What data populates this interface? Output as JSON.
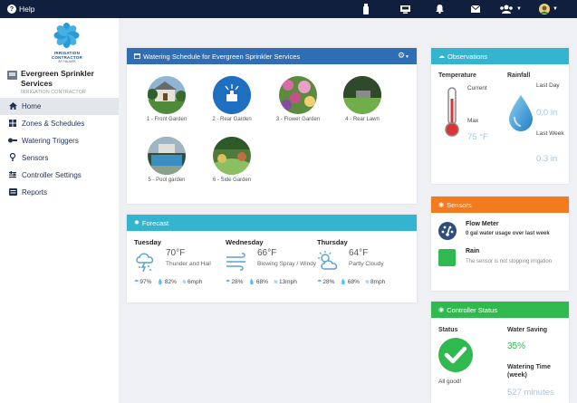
{
  "topbar": {
    "help_label": "Help",
    "icons": [
      "usb-icon",
      "monitor-icon",
      "bell-icon",
      "envelope-icon",
      "users-icon",
      "avatar"
    ]
  },
  "sidebar": {
    "logo_text": "IRRIGATION CONTRACTOR",
    "logo_sub": "BY HAJLER",
    "site_name": "Evergreen Sprinkler Services",
    "site_sub": "IRRIGATION CONTRACTOR",
    "items": [
      {
        "label": "Home",
        "icon": "home-icon",
        "active": true
      },
      {
        "label": "Zones & Schedules",
        "icon": "zones-icon",
        "active": false
      },
      {
        "label": "Watering Triggers",
        "icon": "triggers-icon",
        "active": false
      },
      {
        "label": "Sensors",
        "icon": "sensor-icon",
        "active": false
      },
      {
        "label": "Controller Settings",
        "icon": "settings-icon",
        "active": false
      },
      {
        "label": "Reports",
        "icon": "reports-icon",
        "active": false
      }
    ]
  },
  "schedule": {
    "title": "Watering Schedule for Evergreen Sprinkler Services",
    "zones": [
      {
        "label": "1 - Front Garden"
      },
      {
        "label": "2 - Rear Garden"
      },
      {
        "label": "3 - Flower Garden"
      },
      {
        "label": "4 - Rear Lawn"
      },
      {
        "label": "5 - Pool garden"
      },
      {
        "label": "6 - Side Garden"
      }
    ]
  },
  "forecast": {
    "title": "Forecast",
    "days": [
      {
        "day": "Tuesday",
        "temp": "70°F",
        "cond": "Thunder and Hail",
        "rain": "97%",
        "humidity": "82%",
        "wind": "6mph"
      },
      {
        "day": "Wednesday",
        "temp": "66°F",
        "cond": "Blowing Spray / Windy",
        "rain": "28%",
        "humidity": "68%",
        "wind": "13mph"
      },
      {
        "day": "Thursday",
        "temp": "64°F",
        "cond": "Partly Cloudy",
        "rain": "28%",
        "humidity": "68%",
        "wind": "8mph"
      }
    ]
  },
  "observations": {
    "title": "Observations",
    "temperature_label": "Temperature",
    "current_label": "Current",
    "max_label": "Max",
    "max_value": "75 °F",
    "rainfall_label": "Rainfall",
    "last_day_label": "Last Day",
    "last_day_value": "0.0 in",
    "last_week_label": "Last Week",
    "last_week_value": "0.3 in"
  },
  "sensors": {
    "title": "Sensors",
    "flow_title": "Flow Meter",
    "flow_sub": "0 gal water usage over last week",
    "rain_title": "Rain",
    "rain_sub": "The sensor is not stopping irrigation"
  },
  "controller": {
    "title": "Controller Status",
    "status_label": "Status",
    "status_text": "All good!",
    "water_saving_label": "Water Saving",
    "water_saving_value": "35%",
    "watering_time_label": "Watering Time (week)",
    "watering_time_value": "527 minutes"
  },
  "colors": {
    "topbar": "#0f1f3d",
    "schedule_header": "#2f6db5",
    "cyan_header": "#35b4cf",
    "sensors_header": "#f37b1d",
    "controller_header": "#2fb94f",
    "rain_sensor": "#2fb94f"
  }
}
